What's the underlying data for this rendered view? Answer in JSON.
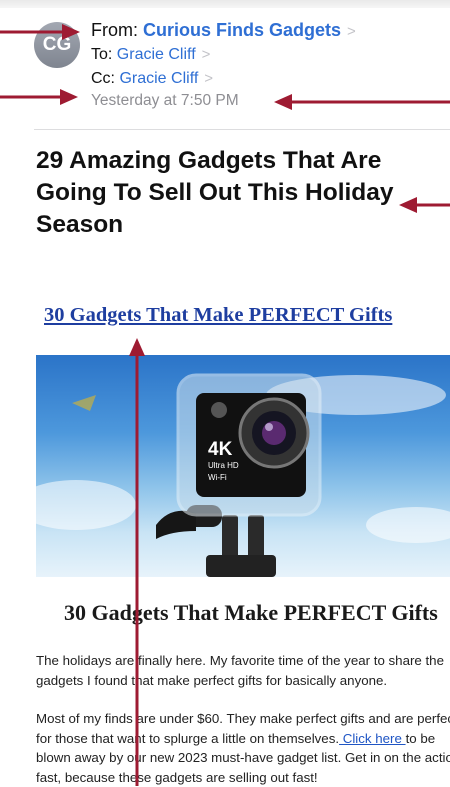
{
  "email": {
    "avatar_initials": "CG",
    "from_label": "From:",
    "from_name": "Curious Finds Gadgets",
    "to_label": "To:",
    "to_name": "Gracie Cliff",
    "cc_label": "Cc:",
    "cc_name": "Gracie Cliff",
    "timestamp": "Yesterday at 7:50 PM",
    "subject": "29 Amazing Gadgets That Are Going To Sell Out This Holiday Season"
  },
  "body": {
    "banner_link": "30 Gadgets That Make PERFECT Gifts",
    "camera_label_4k": "4K",
    "camera_label_ultra": "Ultra HD",
    "camera_label_wifi": "Wi-Fi",
    "headline": "30 Gadgets That Make PERFECT Gifts",
    "para1": "The holidays are finally here. My favorite time of the year to share the gadgets I found that make perfect gifts for basically anyone.",
    "para2_before": "Most of my finds are under $60. They make perfect gifts and are perfect for those that want to splurge a little on themselves.",
    "para2_link": " Click here ",
    "para2_after": "to be blown away by our new 2023 must-have gadget list. Get in on the action fast, because these gadgets are selling out fast!"
  },
  "colors": {
    "link": "#2f6fd4",
    "annotation_arrow": "#9e1b32",
    "banner_link": "#1e3ea0"
  }
}
